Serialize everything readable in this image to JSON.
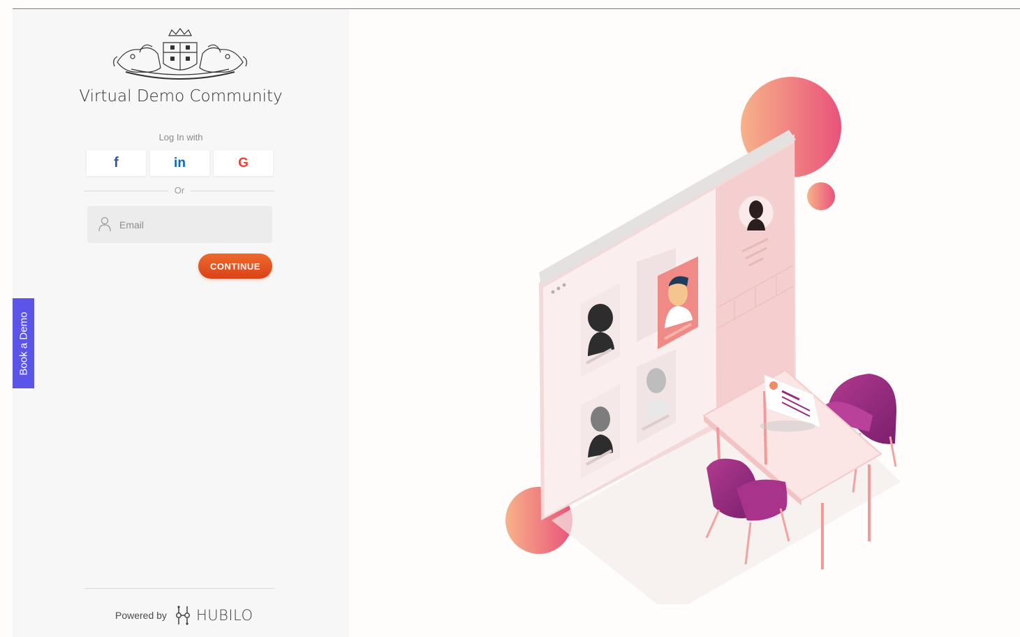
{
  "community": {
    "title": "Virtual Demo Community"
  },
  "login": {
    "login_with_label": "Log In with",
    "social": {
      "facebook_label": "f",
      "linkedin_label": "in",
      "google_label": "G"
    },
    "or_label": "Or",
    "email_placeholder": "Email",
    "continue_label": "CONTINUE"
  },
  "side_tab": {
    "label": "Book a Demo"
  },
  "footer": {
    "powered_by_label": "Powered by",
    "brand_name": "HUBILO"
  },
  "icons": {
    "logo": "emblem-logo",
    "email_field": "user-icon",
    "brand": "hubilo-logo-icon"
  },
  "colors": {
    "accent": "#e4501f",
    "side_tab": "#5a54e8",
    "facebook": "#3b5998",
    "linkedin": "#0a66c2",
    "google": "#e84335",
    "chairs": "#9a2a7f",
    "decor_circle": "#f07a6a"
  }
}
